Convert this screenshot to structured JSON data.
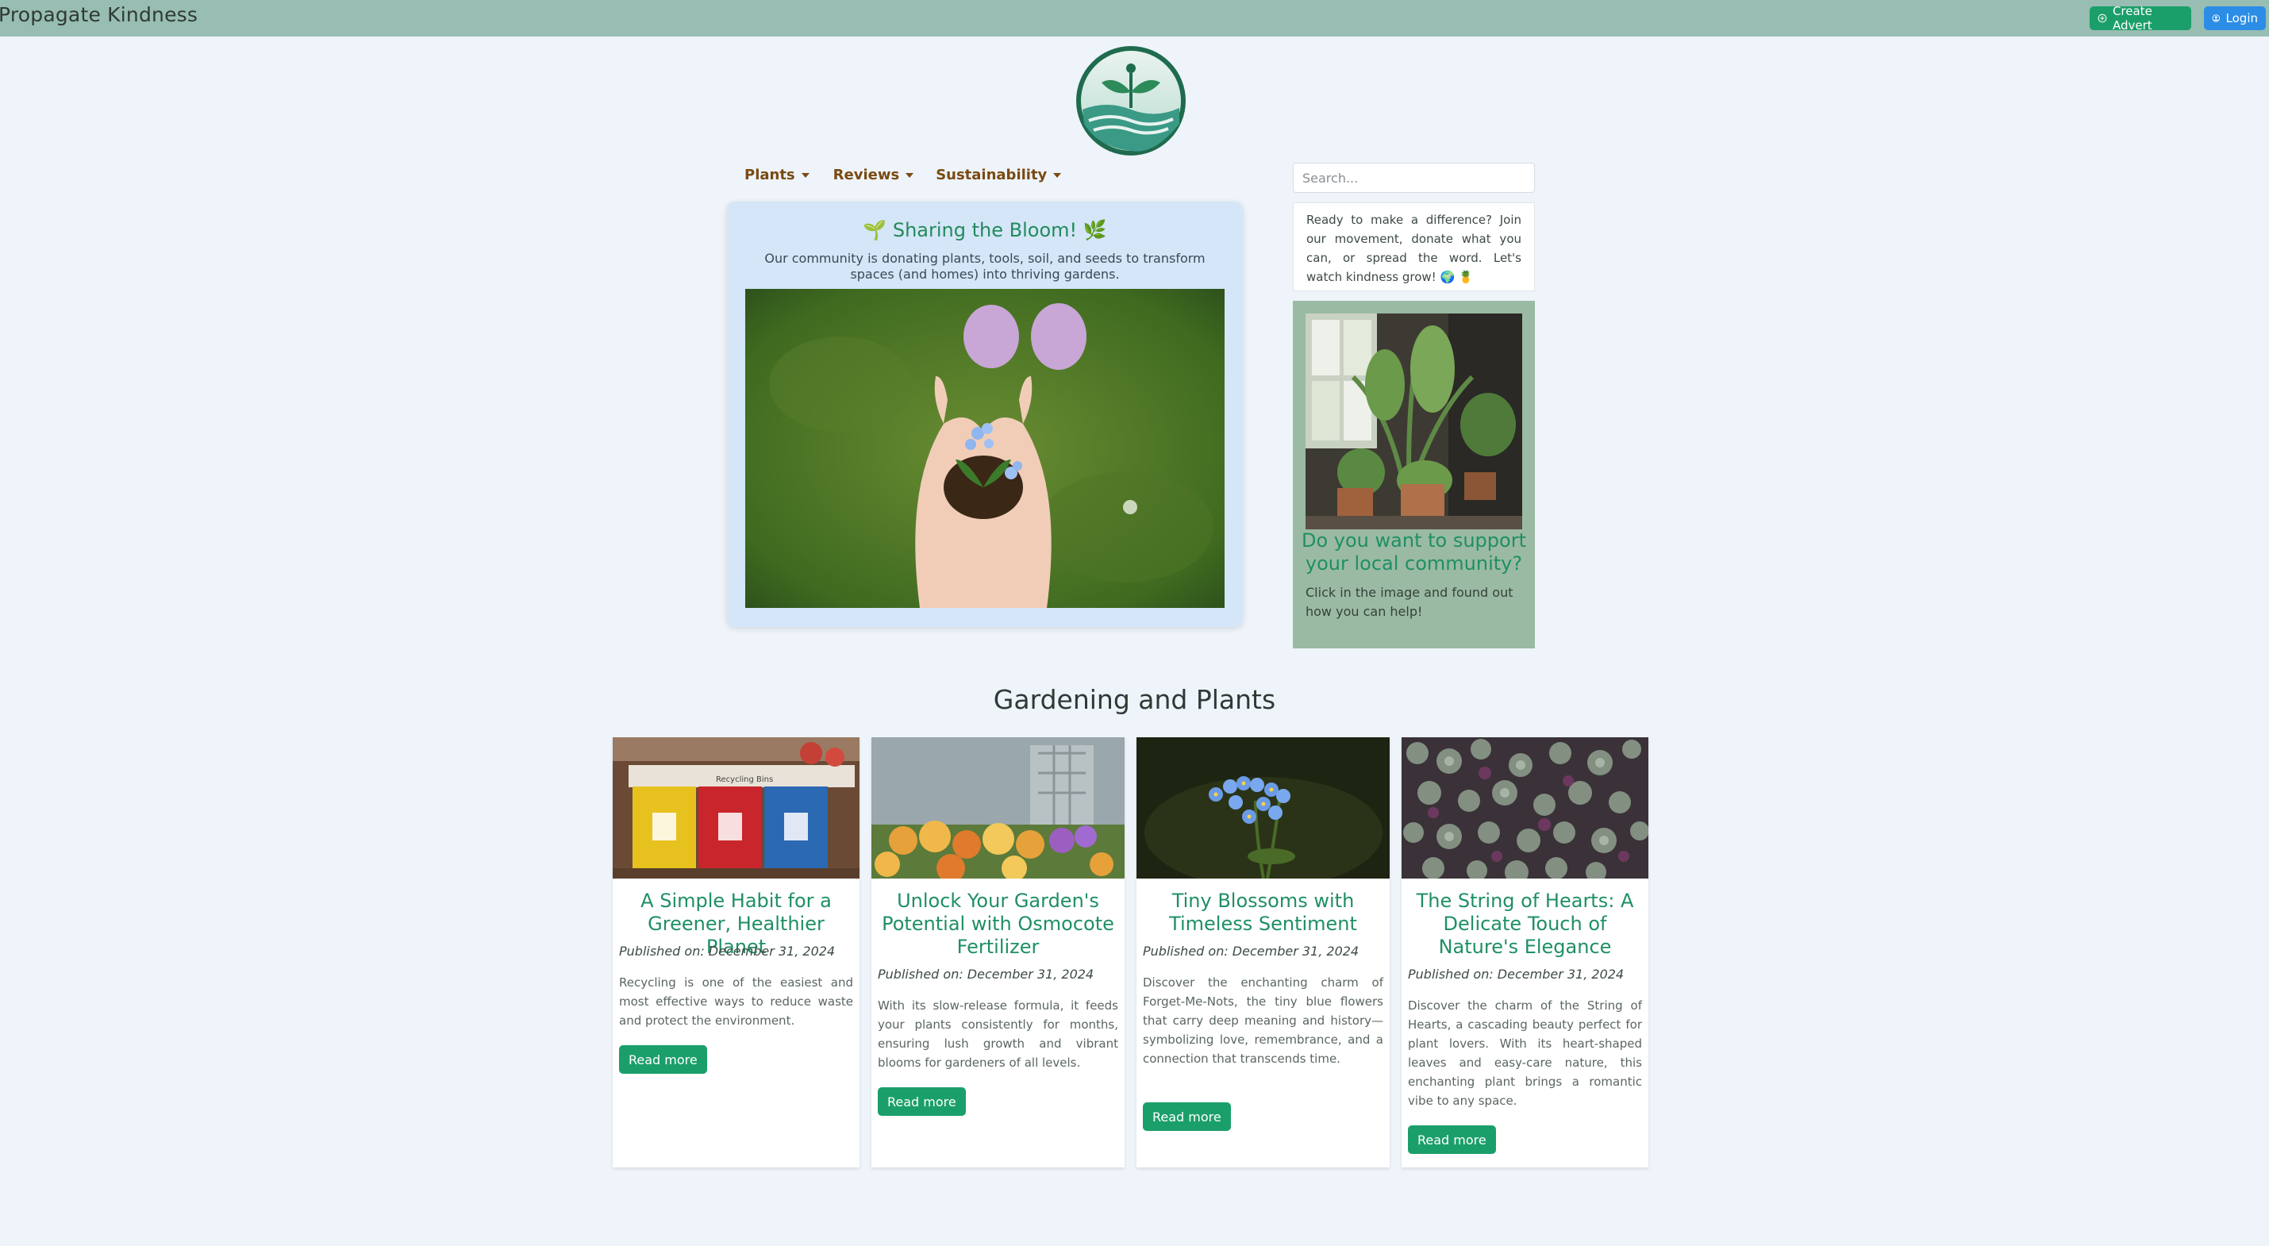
{
  "topbar": {
    "brand": "Propagate Kindness",
    "create_advert": "Create Advert",
    "login": "Login"
  },
  "nav": [
    {
      "label": "Plants"
    },
    {
      "label": "Reviews"
    },
    {
      "label": "Sustainability"
    }
  ],
  "search": {
    "placeholder": "Search..."
  },
  "hero": {
    "title": "🌱 Sharing the Bloom! 🌿",
    "subtitle": "Our community is donating plants, tools, soil, and seeds to transform spaces (and homes) into thriving gardens."
  },
  "sidebar": {
    "intro": "Ready to make a difference? Join our movement, donate what you can, or spread the word. Let's watch kindness grow! 🌍 🍍",
    "support_title": "Do you want to support your local community?",
    "support_text": "Click in the image and found out how you can help!"
  },
  "section": {
    "title": "Gardening and Plants"
  },
  "cards": [
    {
      "title": "A Simple Habit for a Greener, Healthier Planet",
      "date": "Published on: December 31, 2024",
      "text": "Recycling is one of the easiest and most effective ways to reduce waste and protect the environment.",
      "button": "Read more"
    },
    {
      "title": "Unlock Your Garden's Potential with Osmocote Fertilizer",
      "date": "Published on: December 31, 2024",
      "text": "With its slow-release formula, it feeds your plants consistently for months, ensuring lush growth and vibrant blooms for gardeners of all levels.",
      "button": "Read more"
    },
    {
      "title": "Tiny Blossoms with Timeless Sentiment",
      "date": "Published on: December 31, 2024",
      "text": "Discover the enchanting charm of Forget-Me-Nots, the tiny blue flowers that carry deep meaning and history—symbolizing love, remembrance, and a connection that transcends time.",
      "button": "Read more"
    },
    {
      "title": "The String of Hearts: A Delicate Touch of Nature's Elegance",
      "date": "Published on: December 31, 2024",
      "text": "Discover the charm of the String of Hearts, a cascading beauty perfect for plant lovers. With its heart-shaped leaves and easy-care nature, this enchanting plant brings a romantic vibe to any space.",
      "button": "Read more"
    }
  ],
  "images": {
    "recycling_bins_text": "Recycling Bins"
  },
  "colors": {
    "topbar": "#98bdb2",
    "accent_green": "#1b9f6a",
    "login_blue": "#2b8de6",
    "title_green": "#1f8f64",
    "nav_brown": "#7a4a12",
    "hero_bg": "#d4e6f8",
    "support_bg": "#9bbaa3"
  }
}
